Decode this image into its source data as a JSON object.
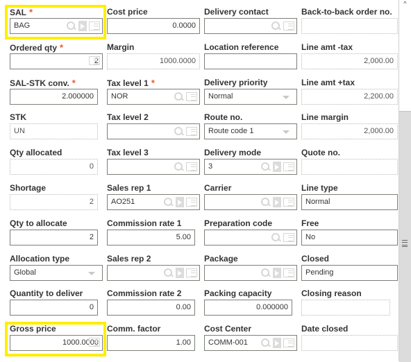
{
  "columns": [
    [
      {
        "label": "SAL",
        "required": true,
        "value": "BAG",
        "type": "input",
        "icons": [
          "search",
          "link",
          "detail"
        ],
        "highlight": true
      },
      {
        "label": "Ordered qty",
        "required": true,
        "value": "2",
        "type": "input",
        "align": "right",
        "icons": [
          "detail"
        ]
      },
      {
        "label": "SAL-STK conv.",
        "required": true,
        "value": "2.000000",
        "type": "input",
        "align": "right",
        "narrow": true
      },
      {
        "label": "STK",
        "value": "UN",
        "type": "readonly",
        "narrow": true
      },
      {
        "label": "Qty allocated",
        "value": "0",
        "type": "readonly",
        "align": "right",
        "narrow": true
      },
      {
        "label": "Shortage",
        "value": "2",
        "type": "readonly",
        "align": "right",
        "narrow": true
      },
      {
        "label": "Qty to allocate",
        "value": "2",
        "type": "input",
        "align": "right",
        "narrow": true
      },
      {
        "label": "Allocation type",
        "value": "Global",
        "type": "select"
      },
      {
        "label": "Quantity to deliver",
        "value": "0",
        "type": "input",
        "align": "right",
        "narrow": true
      },
      {
        "label": "Gross price",
        "value": "1000.0000",
        "type": "input",
        "align": "right",
        "icons": [
          "detail"
        ],
        "highlight": true
      }
    ],
    [
      {
        "label": "Cost price",
        "value": "0.0000",
        "type": "input",
        "align": "right"
      },
      {
        "label": "Margin",
        "value": "1000.0000",
        "type": "readonly",
        "align": "right"
      },
      {
        "label": "Tax level 1",
        "required": true,
        "value": "NOR",
        "type": "input",
        "icons": [
          "search",
          "detail"
        ]
      },
      {
        "label": "Tax level 2",
        "value": "",
        "type": "input",
        "icons": [
          "search",
          "detail"
        ]
      },
      {
        "label": "Tax level 3",
        "value": "",
        "type": "input",
        "icons": [
          "search",
          "detail"
        ]
      },
      {
        "label": "Sales rep 1",
        "value": "AO251",
        "type": "input",
        "icons": [
          "search",
          "link",
          "detail"
        ]
      },
      {
        "label": "Commission rate 1",
        "value": "5.00",
        "type": "input",
        "align": "right",
        "narrow": true
      },
      {
        "label": "Sales rep 2",
        "value": "",
        "type": "input",
        "icons": [
          "search",
          "link",
          "detail"
        ]
      },
      {
        "label": "Commission rate 2",
        "value": "0.00",
        "type": "input",
        "align": "right",
        "narrow": true
      },
      {
        "label": "Comm. factor",
        "value": "1.00",
        "type": "input",
        "align": "right",
        "narrow": true
      }
    ],
    [
      {
        "label": "Delivery contact",
        "value": "",
        "type": "input",
        "icons": [
          "search",
          "detail"
        ]
      },
      {
        "label": "Location reference",
        "value": "",
        "type": "input"
      },
      {
        "label": "Delivery priority",
        "value": "Normal",
        "type": "select"
      },
      {
        "label": "Route no.",
        "value": "Route code 1",
        "type": "select"
      },
      {
        "label": "Delivery mode",
        "value": "3",
        "type": "input",
        "icons": [
          "search",
          "link",
          "detail"
        ]
      },
      {
        "label": "Carrier",
        "value": "",
        "type": "input",
        "icons": [
          "search",
          "link",
          "detail"
        ]
      },
      {
        "label": "Preparation code",
        "value": "",
        "type": "input",
        "icons": [
          "search",
          "detail"
        ]
      },
      {
        "label": "Package",
        "value": "",
        "type": "input",
        "icons": [
          "search",
          "link",
          "detail"
        ]
      },
      {
        "label": "Packing capacity",
        "value": "0.000000",
        "type": "input",
        "align": "right",
        "narrow": true
      },
      {
        "label": "Cost Center",
        "value": "COMM-001",
        "type": "input",
        "icons": [
          "search",
          "link",
          "detail"
        ]
      }
    ],
    [
      {
        "label": "Back-to-back order no.",
        "value": "",
        "type": "readonly"
      },
      {
        "label": "Line amt -tax",
        "value": "2,000.00",
        "type": "readonly",
        "align": "right"
      },
      {
        "label": "Line amt +tax",
        "value": "2,200.00",
        "type": "readonly",
        "align": "right"
      },
      {
        "label": "Line margin",
        "value": "2,000.00",
        "type": "readonly",
        "align": "right"
      },
      {
        "label": "Quote no.",
        "value": "",
        "type": "readonly"
      },
      {
        "label": "Line type",
        "value": "Normal",
        "type": "input"
      },
      {
        "label": "Free",
        "value": "No",
        "type": "input"
      },
      {
        "label": "Closed",
        "value": "Pending",
        "type": "input"
      },
      {
        "label": "Closing reason",
        "value": "",
        "type": "readonly",
        "narrow": true
      },
      {
        "label": "Date closed",
        "value": "",
        "type": "readonly"
      }
    ]
  ],
  "required_mark": "*",
  "highlight_color": "#ffee00",
  "required_color": "#f05a28",
  "scrollbar": {
    "up_arrow": "^"
  }
}
